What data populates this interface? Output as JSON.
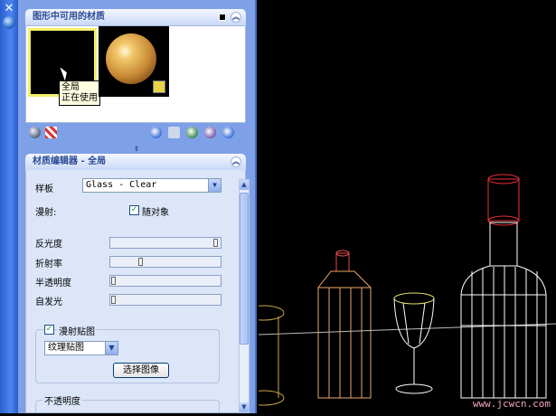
{
  "available_panel": {
    "title": "图形中可用的材质",
    "tooltip": [
      "全局",
      "正在使用"
    ]
  },
  "editor_panel": {
    "title": "材质编辑器 - 全局",
    "template_label": "样板",
    "template_value": "Glass - Clear",
    "diffuse_label": "漫射:",
    "by_object_label": "随对象",
    "by_object_checked": true,
    "sliders": [
      {
        "label": "反光度",
        "value": 0.96
      },
      {
        "label": "折射率",
        "value": 0.27
      },
      {
        "label": "半透明度",
        "value": 0.0
      },
      {
        "label": "自发光",
        "value": 0.0
      }
    ],
    "diffuse_map_label": "漫射贴图",
    "diffuse_map_checked": true,
    "map_type_value": "纹理贴图",
    "select_image_label": "选择图像",
    "opacity_label": "不透明度"
  },
  "watermark": "www.jcwcn.com",
  "colors": {
    "palette_bg": "#7ea0e6",
    "title_strip": "#3a6fe0",
    "viewport_bg": "#000000"
  }
}
